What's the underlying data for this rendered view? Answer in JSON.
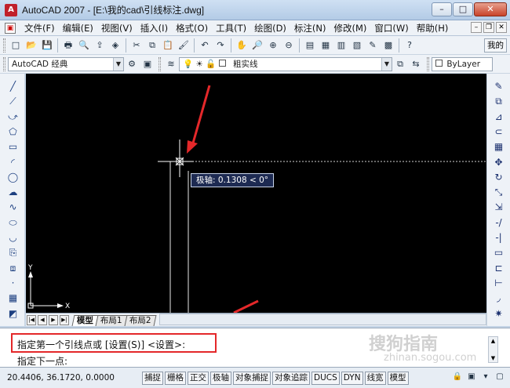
{
  "window": {
    "app_icon": "A",
    "title": "AutoCAD 2007 - [E:\\我的cad\\引线标注.dwg]",
    "controls": {
      "minimize": "–",
      "maximize": "□",
      "close": "✕"
    }
  },
  "menu": {
    "doc_icon": "▣",
    "items": [
      "文件(F)",
      "编辑(E)",
      "视图(V)",
      "插入(I)",
      "格式(O)",
      "工具(T)",
      "绘图(D)",
      "标注(N)",
      "修改(M)",
      "窗口(W)",
      "帮助(H)"
    ],
    "doc_controls": {
      "minimize": "–",
      "restore": "❐",
      "close": "✕"
    }
  },
  "toolbar1": {
    "icons": [
      "new-icon",
      "open-icon",
      "save-icon",
      "print-icon",
      "preview-icon",
      "publish-icon",
      "plot3d-icon",
      "cut-icon",
      "copy-icon",
      "paste-icon",
      "match-icon",
      "undo-icon",
      "redo-icon",
      "pan-icon",
      "zoom-realtime-icon",
      "zoom-window-icon",
      "zoom-prev-icon",
      "properties-icon",
      "design-center-icon",
      "tool-palettes-icon",
      "sheet-set-icon",
      "markup-icon",
      "calculator-icon",
      "help-icon"
    ],
    "glyphs": [
      "□",
      "📂",
      "💾",
      "🖶",
      "🔍",
      "⇪",
      "◈",
      "✂",
      "⧉",
      "📋",
      "🖌",
      "↶",
      "↷",
      "✋",
      "🔎",
      "⊕",
      "⊖",
      "▤",
      "▦",
      "▥",
      "▧",
      "✎",
      "▩",
      "?"
    ],
    "right_label": "我的"
  },
  "toolbar2": {
    "workspace": "AutoCAD 经典",
    "layer_glyphs": [
      "💡",
      "☀",
      "🔓"
    ],
    "layer_name": "粗实线",
    "bylayer": "ByLayer"
  },
  "left_tools": {
    "names": [
      "line-icon",
      "construction-line-icon",
      "polyline-icon",
      "polygon-icon",
      "rectangle-icon",
      "arc-icon",
      "circle-icon",
      "revcloud-icon",
      "spline-icon",
      "ellipse-icon",
      "ellipse-arc-icon",
      "insert-block-icon",
      "make-block-icon",
      "point-icon",
      "hatch-icon",
      "region-icon"
    ],
    "glyphs": [
      "╱",
      "⟋",
      "⤻",
      "⬠",
      "▭",
      "◜",
      "◯",
      "☁",
      "∿",
      "⬭",
      "◡",
      "⎘",
      "⧈",
      "·",
      "▦",
      "◩"
    ]
  },
  "right_tools": {
    "names": [
      "erase-icon",
      "copy-object-icon",
      "mirror-icon",
      "offset-icon",
      "array-icon",
      "move-icon",
      "rotate-icon",
      "scale-icon",
      "stretch-icon",
      "trim-icon",
      "extend-icon",
      "break-icon",
      "join-icon",
      "chamfer-icon",
      "fillet-icon",
      "explode-icon"
    ],
    "glyphs": [
      "✎",
      "⧉",
      "⊿",
      "⊂",
      "▦",
      "✥",
      "↻",
      "⤡",
      "⇲",
      "-/",
      "-|",
      "▭",
      "⊏",
      "⊢",
      "◞",
      "✷"
    ]
  },
  "canvas": {
    "tooltip_label": "极轴",
    "tooltip_value": "0.1308 < 0°",
    "ucs_x": "X",
    "ucs_y": "Y"
  },
  "layout_tabs": {
    "nav": [
      "|◀",
      "◀",
      "▶",
      "▶|"
    ],
    "tabs": [
      "模型",
      "布局1",
      "布局2"
    ]
  },
  "command": {
    "line1": "指定第一个引线点或 [设置(S)] <设置>:",
    "line2": "指定下一点:",
    "scroll_up": "▲",
    "scroll_down": "▼",
    "watermark": "搜狗指南",
    "watermark_url": "zhinan.sogou.com"
  },
  "status": {
    "coordinates": "20.4406, 36.1720, 0.0000",
    "buttons": [
      "捕捉",
      "栅格",
      "正交",
      "极轴",
      "对象捕捉",
      "对象追踪",
      "DUCS",
      "DYN",
      "线宽",
      "模型"
    ],
    "icons": [
      "lock-icon",
      "tray-icon",
      "status-menu-icon",
      "clean-screen-icon"
    ],
    "icon_glyphs": [
      "🔒",
      "▣",
      "▾",
      "▢"
    ]
  },
  "colors": {
    "annotation_red": "#e4282a",
    "canvas_bg": "#000000",
    "tooltip_bg": "#1d2a52"
  }
}
